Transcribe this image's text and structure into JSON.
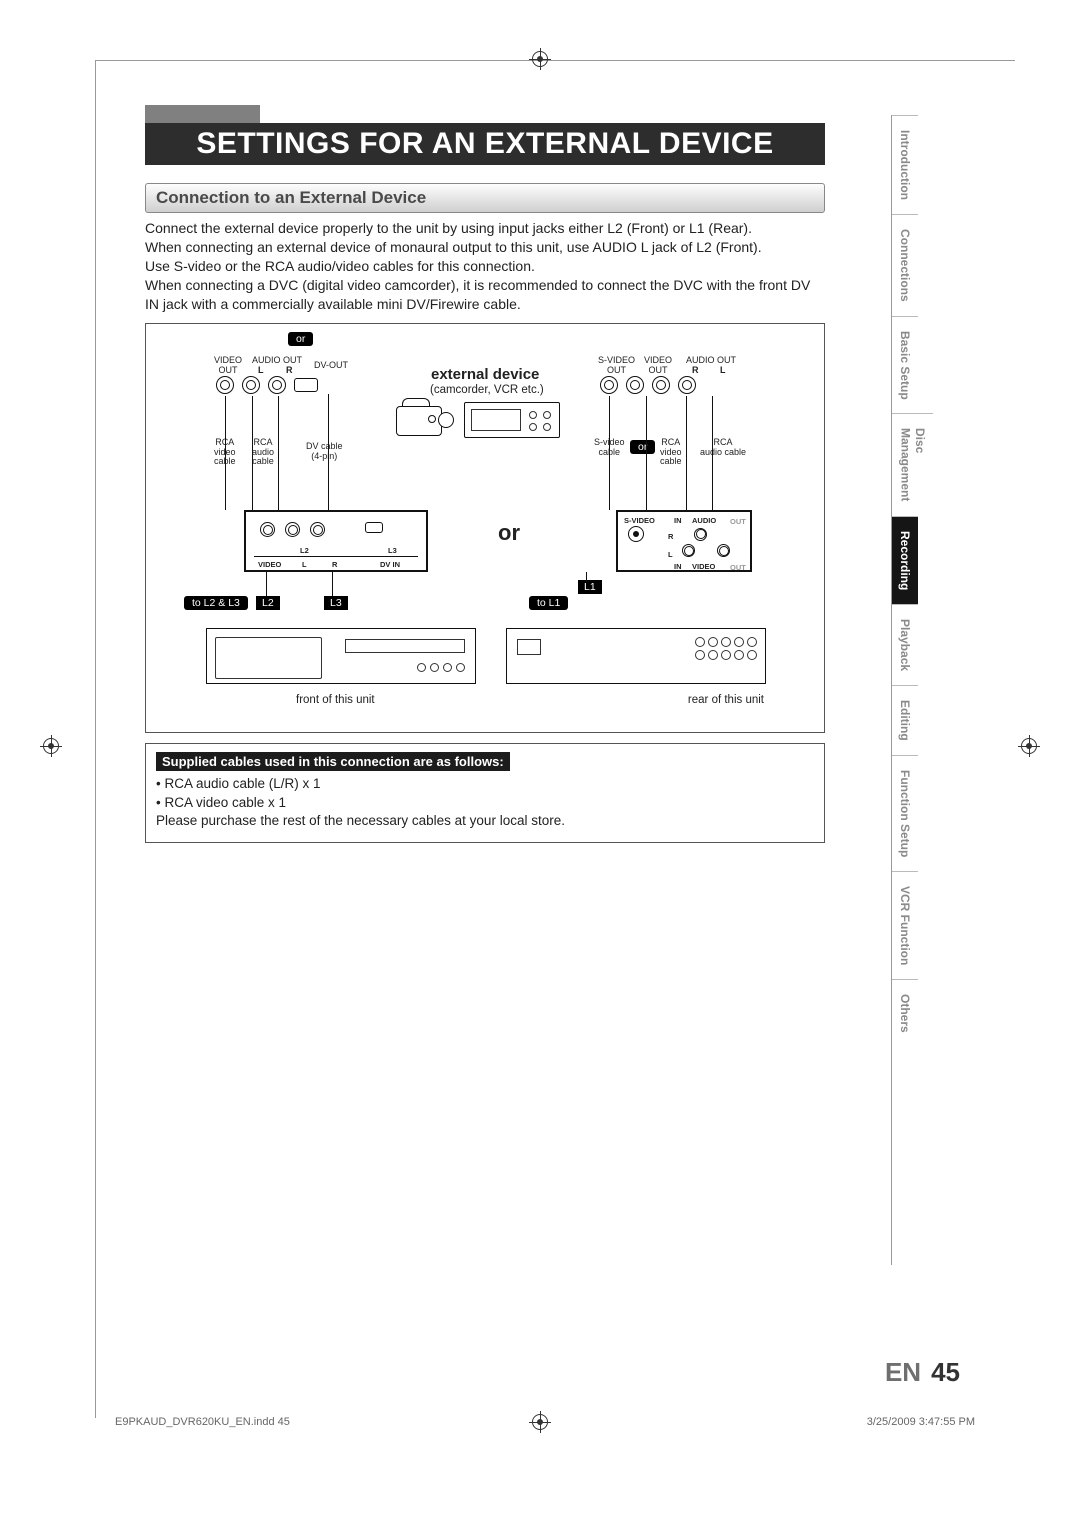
{
  "title": "SETTINGS FOR AN EXTERNAL DEVICE",
  "section_header": "Connection to an External Device",
  "intro": {
    "p1": "Connect the external device properly to the unit by using input jacks either L2 (Front) or L1 (Rear).",
    "p2": "When connecting an external device of monaural output to this unit, use AUDIO L jack of L2 (Front).",
    "p3": "Use S-video or the RCA audio/video cables for this connection.",
    "p4": "When connecting a DVC (digital video camcorder), it is recommended to connect the DVC with the front DV IN jack with a commercially available mini DV/Firewire cable."
  },
  "diagram": {
    "or_pill_top": "or",
    "or_pill_mid": "or",
    "big_or": "or",
    "ext_label": "external device",
    "ext_sub": "(camcorder, VCR etc.)",
    "jack_labels_left": {
      "video_out": "VIDEO\nOUT",
      "audio_out": "AUDIO OUT",
      "L": "L",
      "R": "R",
      "dv_out": "DV-OUT"
    },
    "jack_labels_right": {
      "s_video_out": "S-VIDEO\nOUT",
      "video_out": "VIDEO\nOUT",
      "audio_out": "AUDIO OUT",
      "R": "R",
      "L": "L"
    },
    "cable_labels_left": {
      "rca_video": "RCA\nvideo\ncable",
      "rca_audio": "RCA\naudio\ncable",
      "dv_cable": "DV cable\n(4-pin)"
    },
    "cable_labels_right": {
      "s_video": "S-video\ncable",
      "rca_video": "RCA\nvideo\ncable",
      "rca_audio": "RCA\naudio cable"
    },
    "panel_front": {
      "L2": "L2",
      "L3": "L3",
      "VIDEO": "VIDEO",
      "L": "L",
      "R": "R",
      "DV_IN": "DV IN"
    },
    "panel_rear": {
      "S_VIDEO": "S-VIDEO",
      "IN": "IN",
      "AUDIO": "AUDIO",
      "OUT": "OUT",
      "R": "R",
      "L": "L",
      "VIDEO": "VIDEO"
    },
    "callout_to_L2_L3": "to L2 & L3",
    "callout_L2": "L2",
    "callout_L3": "L3",
    "callout_to_L1": "to L1",
    "callout_L1": "L1",
    "front_caption": "front of this unit",
    "rear_caption": "rear of this unit"
  },
  "supplied": {
    "header": "Supplied cables used in this connection are as follows:",
    "item1": "• RCA audio cable (L/R) x 1",
    "item2": "• RCA video cable x 1",
    "note": "Please purchase the rest of the necessary cables at your local store."
  },
  "tabs": {
    "t1": "Introduction",
    "t2": "Connections",
    "t3": "Basic Setup",
    "t4a": "Disc",
    "t4b": "Management",
    "t5": "Recording",
    "t6": "Playback",
    "t7": "Editing",
    "t8": "Function Setup",
    "t9": "VCR Function",
    "t10": "Others"
  },
  "page_number": {
    "lang": "EN",
    "num": "45"
  },
  "footer": {
    "left": "E9PKAUD_DVR620KU_EN.indd   45",
    "right": "3/25/2009   3:47:55 PM"
  }
}
